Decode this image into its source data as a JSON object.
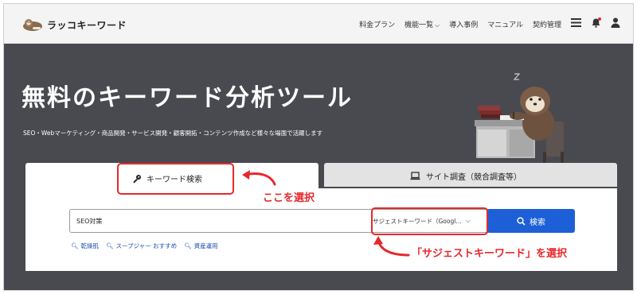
{
  "header": {
    "logo_text": "ラッコキーワード",
    "nav": [
      {
        "label": "料金プラン",
        "dropdown": false
      },
      {
        "label": "機能一覧",
        "dropdown": true
      },
      {
        "label": "導入事例",
        "dropdown": false
      },
      {
        "label": "マニュアル",
        "dropdown": false
      },
      {
        "label": "契約管理",
        "dropdown": false
      }
    ],
    "icons": [
      "hamburger-menu-icon",
      "bell-icon",
      "user-icon"
    ],
    "notification_dot_color": "#e6282b"
  },
  "hero": {
    "title": "無料のキーワード分析ツール",
    "subtitle": "SEO・Webマーケティング・商品開発・サービス開発・顧客開拓・コンテンツ作成など様々な場面で活躍します",
    "background": "#494a50"
  },
  "tabs": [
    {
      "label": "キーワード検索",
      "icon": "key-icon",
      "active": true
    },
    {
      "label": "サイト調査（競合調査等）",
      "icon": "laptop-icon",
      "active": false
    }
  ],
  "search": {
    "value": "SEO対策",
    "select_value": "サジェストキーワード（Googl…",
    "button_label": "検索",
    "button_color": "#1d5fd6"
  },
  "quick_links": [
    "乾燥肌",
    "スープジャー おすすめ",
    "資産運用"
  ],
  "annotations": {
    "label1": "ここを選択",
    "label2": "「サジェストキーワード」を選択",
    "color": "#e6282b"
  }
}
